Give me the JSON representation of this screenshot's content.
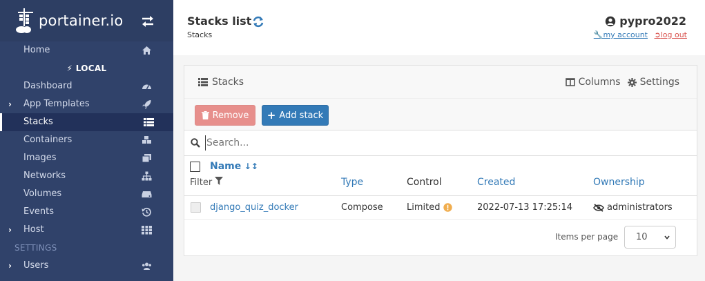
{
  "brand": {
    "logo_text": "portainer.io"
  },
  "sidebar": {
    "home": "Home",
    "endpoint": "LOCAL",
    "items": [
      {
        "label": "Dashboard",
        "icon": "tachometer-icon",
        "chevron": false,
        "active": false
      },
      {
        "label": "App Templates",
        "icon": "rocket-icon",
        "chevron": true,
        "active": false
      },
      {
        "label": "Stacks",
        "icon": "th-list-icon",
        "chevron": false,
        "active": true
      },
      {
        "label": "Containers",
        "icon": "cubes-icon",
        "chevron": false,
        "active": false
      },
      {
        "label": "Images",
        "icon": "clone-icon",
        "chevron": false,
        "active": false
      },
      {
        "label": "Networks",
        "icon": "sitemap-icon",
        "chevron": false,
        "active": false
      },
      {
        "label": "Volumes",
        "icon": "hdd-icon",
        "chevron": false,
        "active": false
      },
      {
        "label": "Events",
        "icon": "history-icon",
        "chevron": false,
        "active": false
      },
      {
        "label": "Host",
        "icon": "th-icon",
        "chevron": true,
        "active": false
      }
    ],
    "settings_heading": "SETTINGS",
    "users": "Users"
  },
  "header": {
    "title": "Stacks list",
    "breadcrumb": "Stacks",
    "username": "pypro2022",
    "my_account": "my account",
    "log_out": "log out"
  },
  "widget": {
    "title": "Stacks",
    "columns_label": "Columns",
    "settings_label": "Settings",
    "remove_label": "Remove",
    "add_label": "Add stack",
    "search_placeholder": "Search...",
    "headers": {
      "name": "Name",
      "filter": "Filter",
      "type": "Type",
      "control": "Control",
      "created": "Created",
      "ownership": "Ownership"
    },
    "rows": [
      {
        "name": "django_quiz_docker",
        "type": "Compose",
        "control": "Limited",
        "created": "2022-07-13 17:25:14",
        "ownership": "administrators"
      }
    ],
    "items_per_page_label": "Items per page",
    "items_per_page_value": "10"
  },
  "colors": {
    "sidebar_bg": "#30426a",
    "link_blue": "#337ab7",
    "remove_red": "#e78f8c",
    "warning_orange": "#f0ad4e",
    "logout_red": "#d9534f"
  }
}
